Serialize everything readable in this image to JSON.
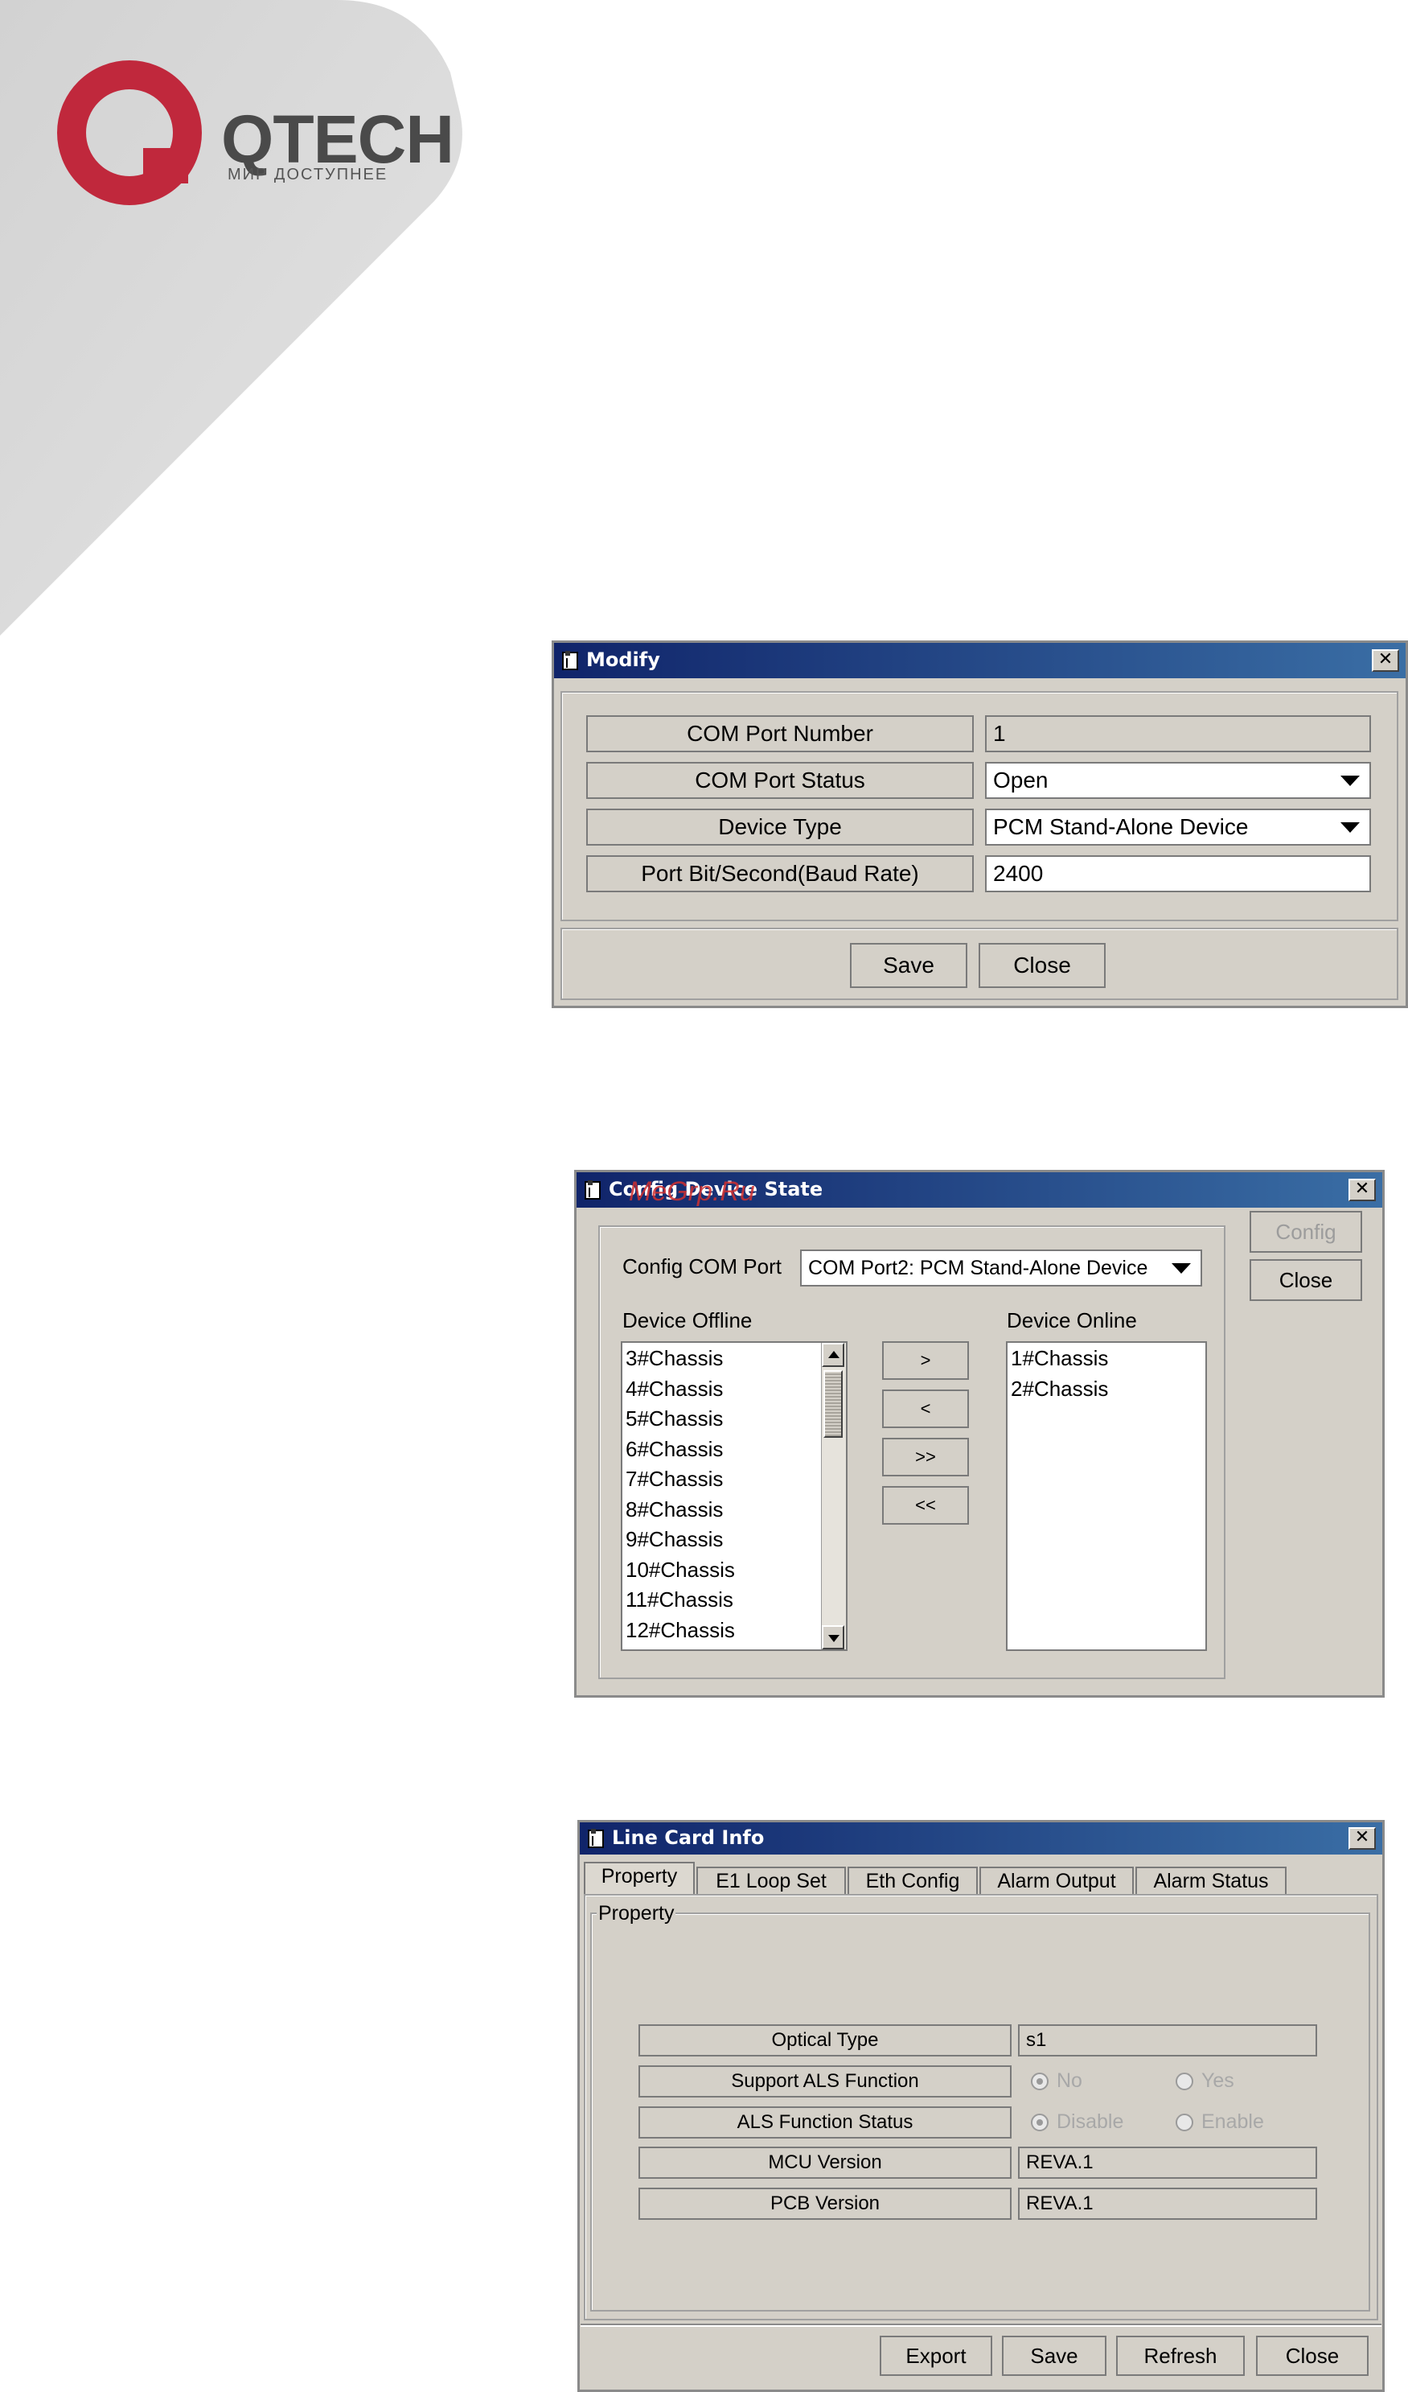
{
  "logo": {
    "wordmark": "QTECH",
    "tagline": "МИР ДОСТУПНЕЕ",
    "brand_color": "#c0283c"
  },
  "watermark": "MeGrp.Ru",
  "modify_dialog": {
    "title": "Modify",
    "fields": [
      {
        "label": "COM Port Number",
        "value": "1"
      },
      {
        "label": "COM Port Status",
        "value": "Open"
      },
      {
        "label": "Device Type",
        "value": "PCM Stand-Alone Device"
      },
      {
        "label": "Port Bit/Second(Baud Rate)",
        "value": "2400"
      }
    ],
    "save_label": "Save",
    "close_label": "Close"
  },
  "config_dialog": {
    "title": "Config Device State",
    "com_port_label": "Config COM Port",
    "com_port_value": "COM Port2:  PCM Stand-Alone Device",
    "offline_label": "Device Offline",
    "online_label": "Device Online",
    "offline_items": [
      "3#Chassis",
      "4#Chassis",
      "5#Chassis",
      "6#Chassis",
      "7#Chassis",
      "8#Chassis",
      "9#Chassis",
      "10#Chassis",
      "11#Chassis",
      "12#Chassis"
    ],
    "online_items": [
      "1#Chassis",
      "2#Chassis"
    ],
    "move_right_label": ">",
    "move_left_label": "<",
    "move_all_right_label": ">>",
    "move_all_left_label": "<<",
    "config_label": "Config",
    "close_label": "Close"
  },
  "linecard_dialog": {
    "title": "Line Card Info",
    "tabs": [
      "Property",
      "E1 Loop Set",
      "Eth Config",
      "Alarm Output",
      "Alarm Status"
    ],
    "group_label": "Property",
    "optical_type_label": "Optical Type",
    "optical_type_value": "s1",
    "support_als_label": "Support ALS Function",
    "support_als_no": "No",
    "support_als_yes": "Yes",
    "als_status_label": "ALS Function Status",
    "als_status_disable": "Disable",
    "als_status_enable": "Enable",
    "mcu_version_label": "MCU Version",
    "mcu_version_value": "REVA.1",
    "pcb_version_label": "PCB Version",
    "pcb_version_value": "REVA.1",
    "export_label": "Export",
    "save_label": "Save",
    "refresh_label": "Refresh",
    "close_label": "Close"
  }
}
